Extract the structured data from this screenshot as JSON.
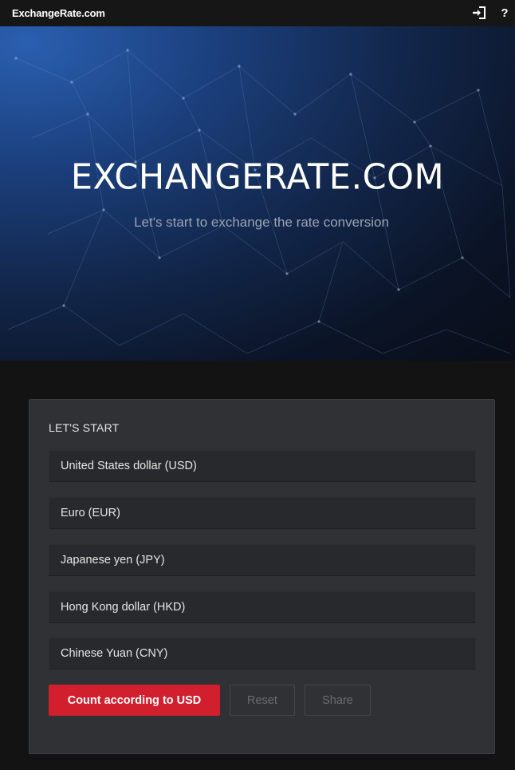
{
  "topbar": {
    "brand": "ExchangeRate.com",
    "icons": [
      "sign-in-icon",
      "help-icon"
    ],
    "help_glyph": "?"
  },
  "hero": {
    "title": "EXCHANGERATE.COM",
    "subtitle": "Let's start to exchange the rate conversion"
  },
  "panel": {
    "heading": "LET'S START",
    "currencies": [
      "United States dollar (USD)",
      "Euro (EUR)",
      "Japanese yen (JPY)",
      "Hong Kong dollar (HKD)",
      "Chinese Yuan (CNY)"
    ],
    "buttons": {
      "count": "Count according to USD",
      "reset": "Reset",
      "share": "Share"
    }
  },
  "colors": {
    "accent": "#d11f2d",
    "page_bg": "#131313",
    "panel_bg": "#303134",
    "field_bg": "#28292c"
  }
}
